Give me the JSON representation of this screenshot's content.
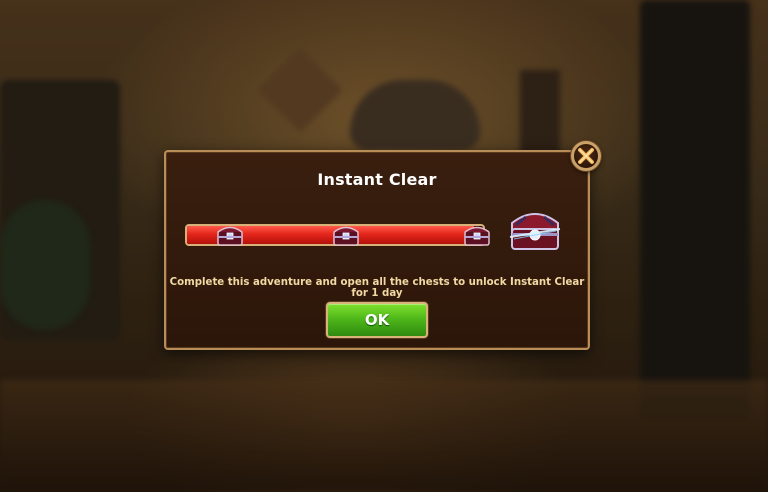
{
  "dialog": {
    "title": "Instant Clear",
    "description": "Complete this adventure and open all the chests to unlock Instant Clear for 1 day",
    "ok_label": "OK",
    "close_icon": "close-icon"
  },
  "progress": {
    "fill_fraction": 0.97,
    "milestones": 3,
    "milestone_icon": "chest-icon",
    "reward_icon": "chest-icon"
  },
  "colors": {
    "progress_fill": "#e4261c",
    "ok_button": "#4fb81a",
    "frame_border": "#b88d57",
    "description_text": "#f2d9a3"
  }
}
